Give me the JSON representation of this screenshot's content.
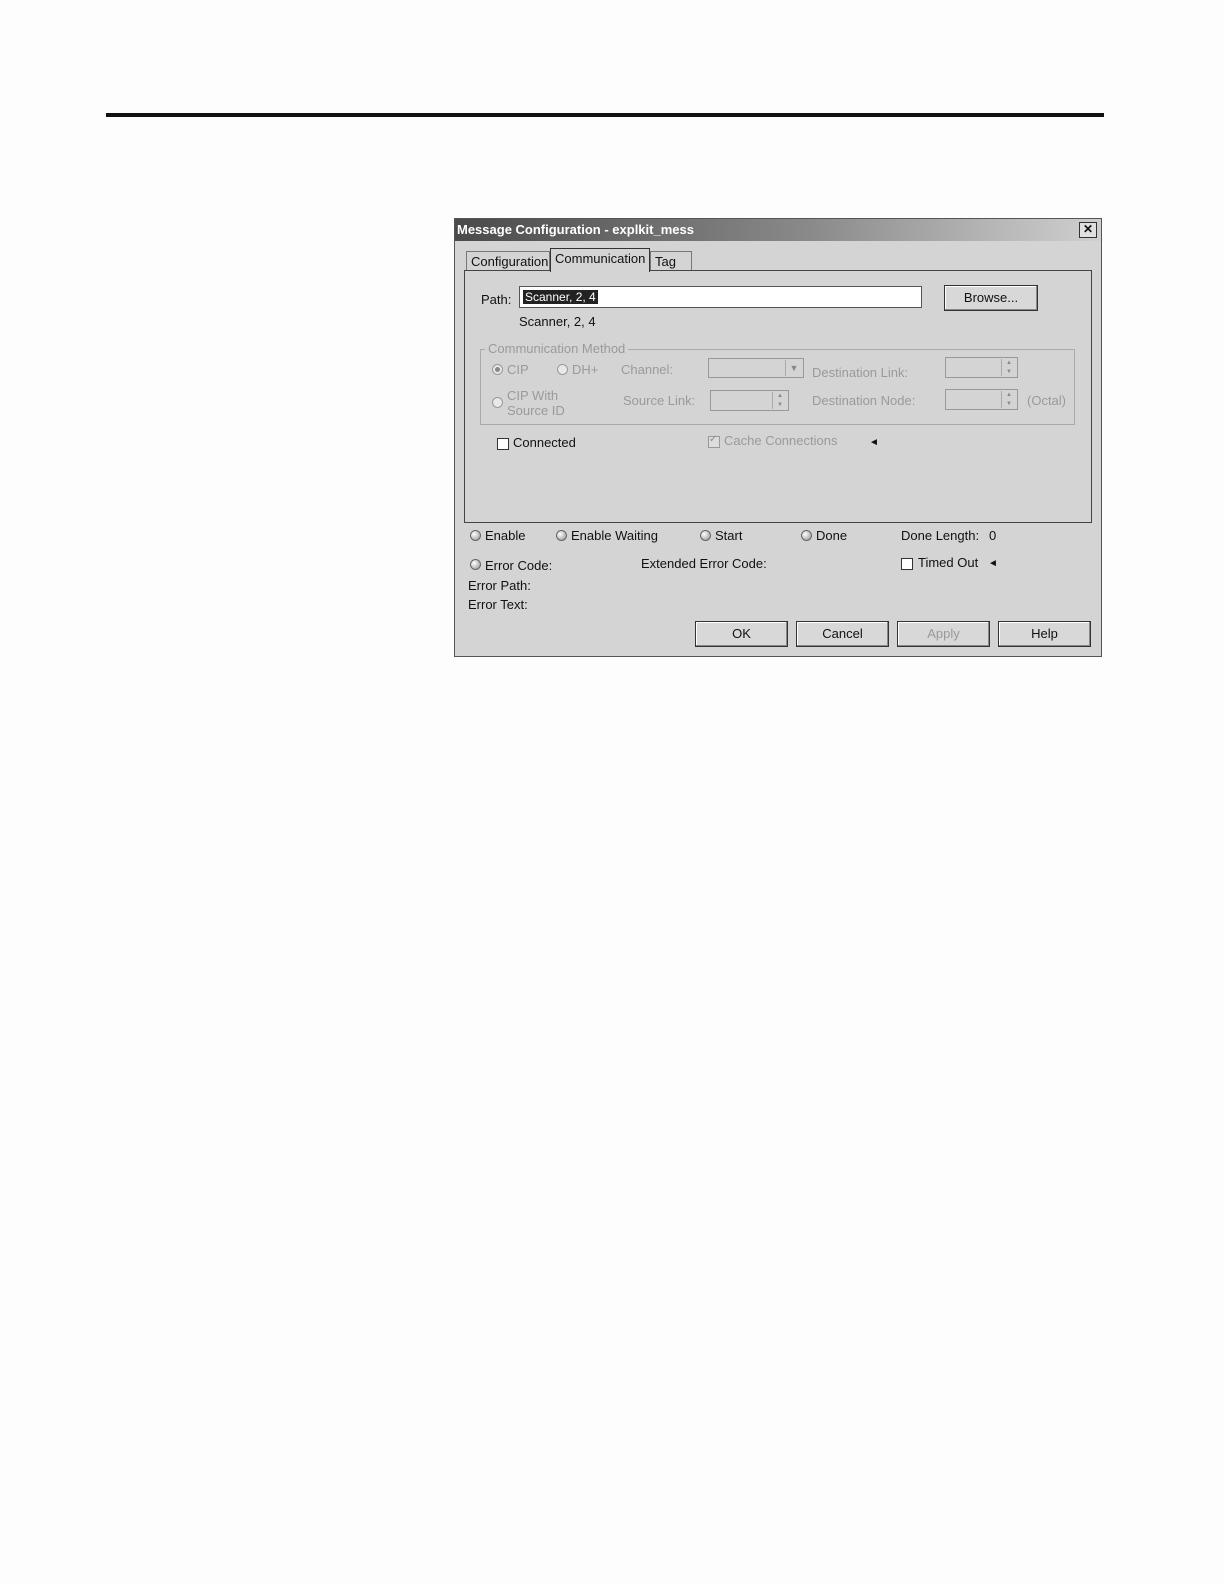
{
  "window": {
    "title": "Message Configuration - explkit_mess",
    "close_glyph": "✕"
  },
  "tabs": [
    {
      "label": "Configuration",
      "active": false
    },
    {
      "label": "Communication",
      "active": true
    },
    {
      "label": "Tag",
      "active": false
    }
  ],
  "path": {
    "label": "Path:",
    "value": "Scanner, 2, 4",
    "resolved": "Scanner, 2, 4",
    "browse_label": "Browse..."
  },
  "comm_method": {
    "group_label": "Communication Method",
    "cip_label": "CIP",
    "dh_label": "DH+",
    "cip_source_line1": "CIP With",
    "cip_source_line2": "Source ID",
    "channel_label": "Channel:",
    "source_link_label": "Source Link:",
    "destination_link_label": "Destination Link:",
    "destination_node_label": "Destination Node:",
    "octal_label": "(Octal)"
  },
  "options": {
    "connected_label": "Connected",
    "cache_label": "Cache Connections",
    "cache_arrow": "◄"
  },
  "status": {
    "enable": "Enable",
    "enable_waiting": "Enable Waiting",
    "start": "Start",
    "done": "Done",
    "done_length_label": "Done Length:",
    "done_length_value": "0",
    "error_code": "Error Code:",
    "extended_error_code": "Extended Error Code:",
    "timed_out": "Timed Out",
    "timed_out_arrow": "◄",
    "error_path": "Error Path:",
    "error_text": "Error Text:"
  },
  "buttons": {
    "ok": "OK",
    "cancel": "Cancel",
    "apply": "Apply",
    "help": "Help"
  }
}
